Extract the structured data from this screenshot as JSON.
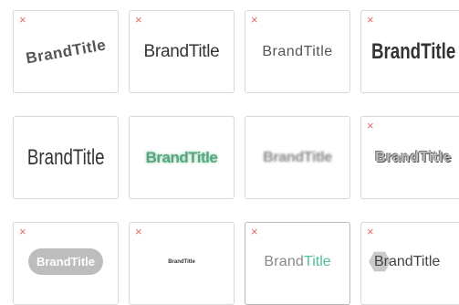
{
  "close_glyph": "×",
  "cards": [
    {
      "id": "1",
      "text": "BrandTitle",
      "has_close": true
    },
    {
      "id": "2",
      "text": "BrandTitle",
      "has_close": true
    },
    {
      "id": "3",
      "text": "BrandTitle",
      "has_close": true
    },
    {
      "id": "4",
      "text": "BrandTitle",
      "has_close": true
    },
    {
      "id": "5",
      "text": "BrandTitle",
      "has_close": false
    },
    {
      "id": "6",
      "text": "BrandTitle",
      "has_close": false
    },
    {
      "id": "7",
      "text": "BrandTitle",
      "has_close": false
    },
    {
      "id": "8",
      "text": "BrandTitle",
      "has_close": true
    },
    {
      "id": "9",
      "text": "BrandTitle",
      "has_close": true
    },
    {
      "id": "10",
      "text": "BrandTitle",
      "has_close": true
    },
    {
      "id": "11",
      "text_part1": "Brand",
      "text_part2": "Title",
      "has_close": true,
      "accent": "#4fbf9f"
    },
    {
      "id": "12",
      "text": "BrandTitle",
      "has_close": true
    }
  ]
}
